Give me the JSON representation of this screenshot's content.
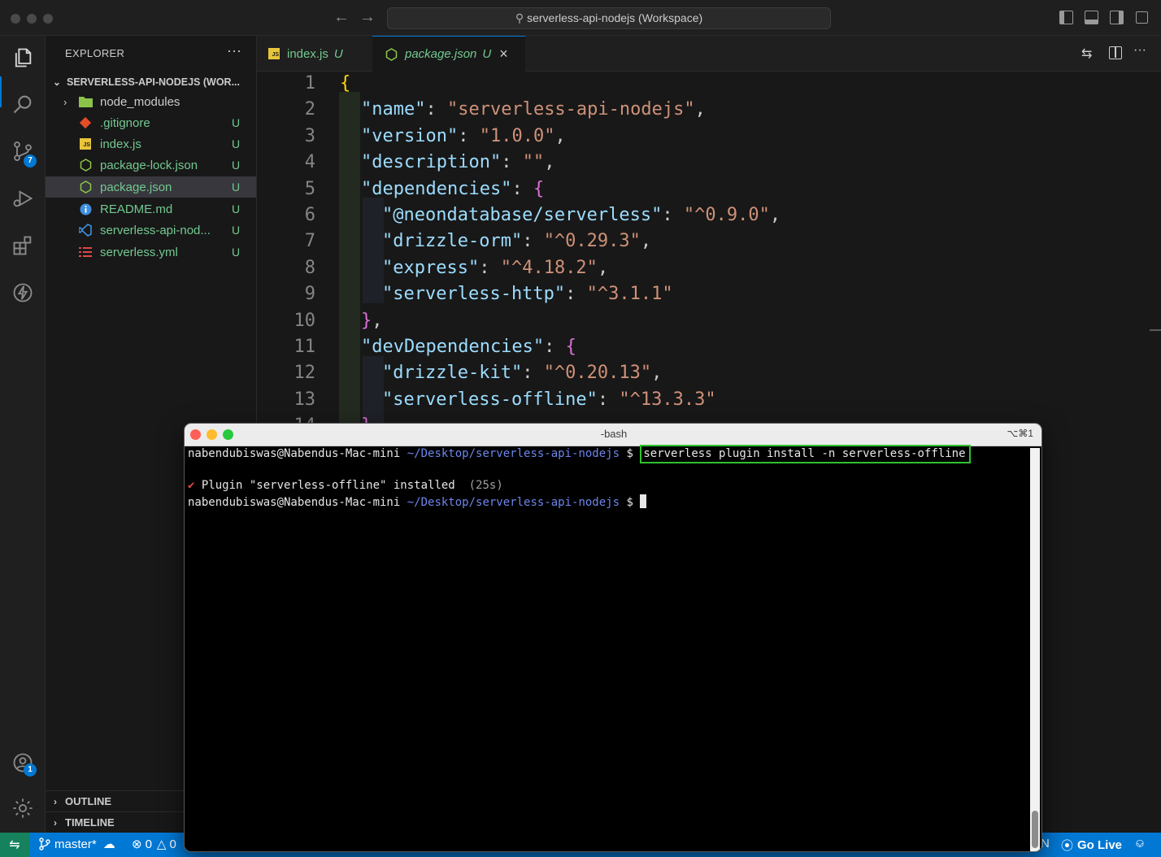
{
  "titlebar": {
    "search_text": "serverless-api-nodejs (Workspace)",
    "back_icon": "arrow-left-icon",
    "forward_icon": "arrow-right-icon"
  },
  "activity_bar": {
    "items": [
      "explorer",
      "search",
      "source-control",
      "run-and-debug",
      "extensions",
      "thunder-client"
    ],
    "source_control_badge": "7",
    "accounts_badge": "1"
  },
  "sidebar": {
    "header": "EXPLORER",
    "more": "···",
    "workspace": "SERVERLESS-API-NODEJS (WOR...",
    "files": [
      {
        "name": "node_modules",
        "status": "",
        "icon": "folder-icon"
      },
      {
        "name": ".gitignore",
        "status": "U",
        "icon": "git-icon"
      },
      {
        "name": "index.js",
        "status": "U",
        "icon": "js-icon"
      },
      {
        "name": "package-lock.json",
        "status": "U",
        "icon": "nodejs-icon"
      },
      {
        "name": "package.json",
        "status": "U",
        "icon": "nodejs-icon"
      },
      {
        "name": "README.md",
        "status": "U",
        "icon": "info-icon"
      },
      {
        "name": "serverless-api-nod...",
        "status": "U",
        "icon": "vscode-icon"
      },
      {
        "name": "serverless.yml",
        "status": "U",
        "icon": "yaml-icon"
      }
    ],
    "sections": [
      "OUTLINE",
      "TIMELINE"
    ]
  },
  "tabs": [
    {
      "name": "index.js",
      "status": "U"
    },
    {
      "name": "package.json",
      "status": "U",
      "close": "×"
    }
  ],
  "editor": {
    "line_numbers": [
      "1",
      "2",
      "3",
      "4",
      "5",
      "6",
      "7",
      "8",
      "9",
      "10",
      "11",
      "12",
      "13",
      "14"
    ],
    "tokens": {
      "name_key": "\"name\"",
      "name_val": "\"serverless-api-nodejs\"",
      "version_key": "\"version\"",
      "version_val": "\"1.0.0\"",
      "desc_key": "\"description\"",
      "desc_val": "\"\"",
      "deps_key": "\"dependencies\"",
      "neon_key": "\"@neondatabase/serverless\"",
      "neon_val": "\"^0.9.0\"",
      "drizzle_key": "\"drizzle-orm\"",
      "drizzle_val": "\"^0.29.3\"",
      "express_key": "\"express\"",
      "express_val": "\"^4.18.2\"",
      "shttp_key": "\"serverless-http\"",
      "shttp_val": "\"^3.1.1\"",
      "devdeps_key": "\"devDependencies\"",
      "dkit_key": "\"drizzle-kit\"",
      "dkit_val": "\"^0.20.13\"",
      "soff_key": "\"serverless-offline\"",
      "soff_val": "\"^13.3.3\""
    }
  },
  "terminal": {
    "title": "-bash",
    "shortcut": "⌥⌘1",
    "prompt_user": "nabendubiswas@Nabendus-Mac-mini",
    "prompt_path": "~/Desktop/serverless-api-nodejs",
    "prompt_symbol": "$",
    "command": "serverless plugin install -n serverless-offline",
    "check": "✔",
    "result": "Plugin \"serverless-offline\" installed",
    "duration": "(25s)"
  },
  "statusbar": {
    "branch": "master*",
    "errors": "0",
    "warnings": "0",
    "go_live": "Go Live",
    "right_stub": "N"
  }
}
